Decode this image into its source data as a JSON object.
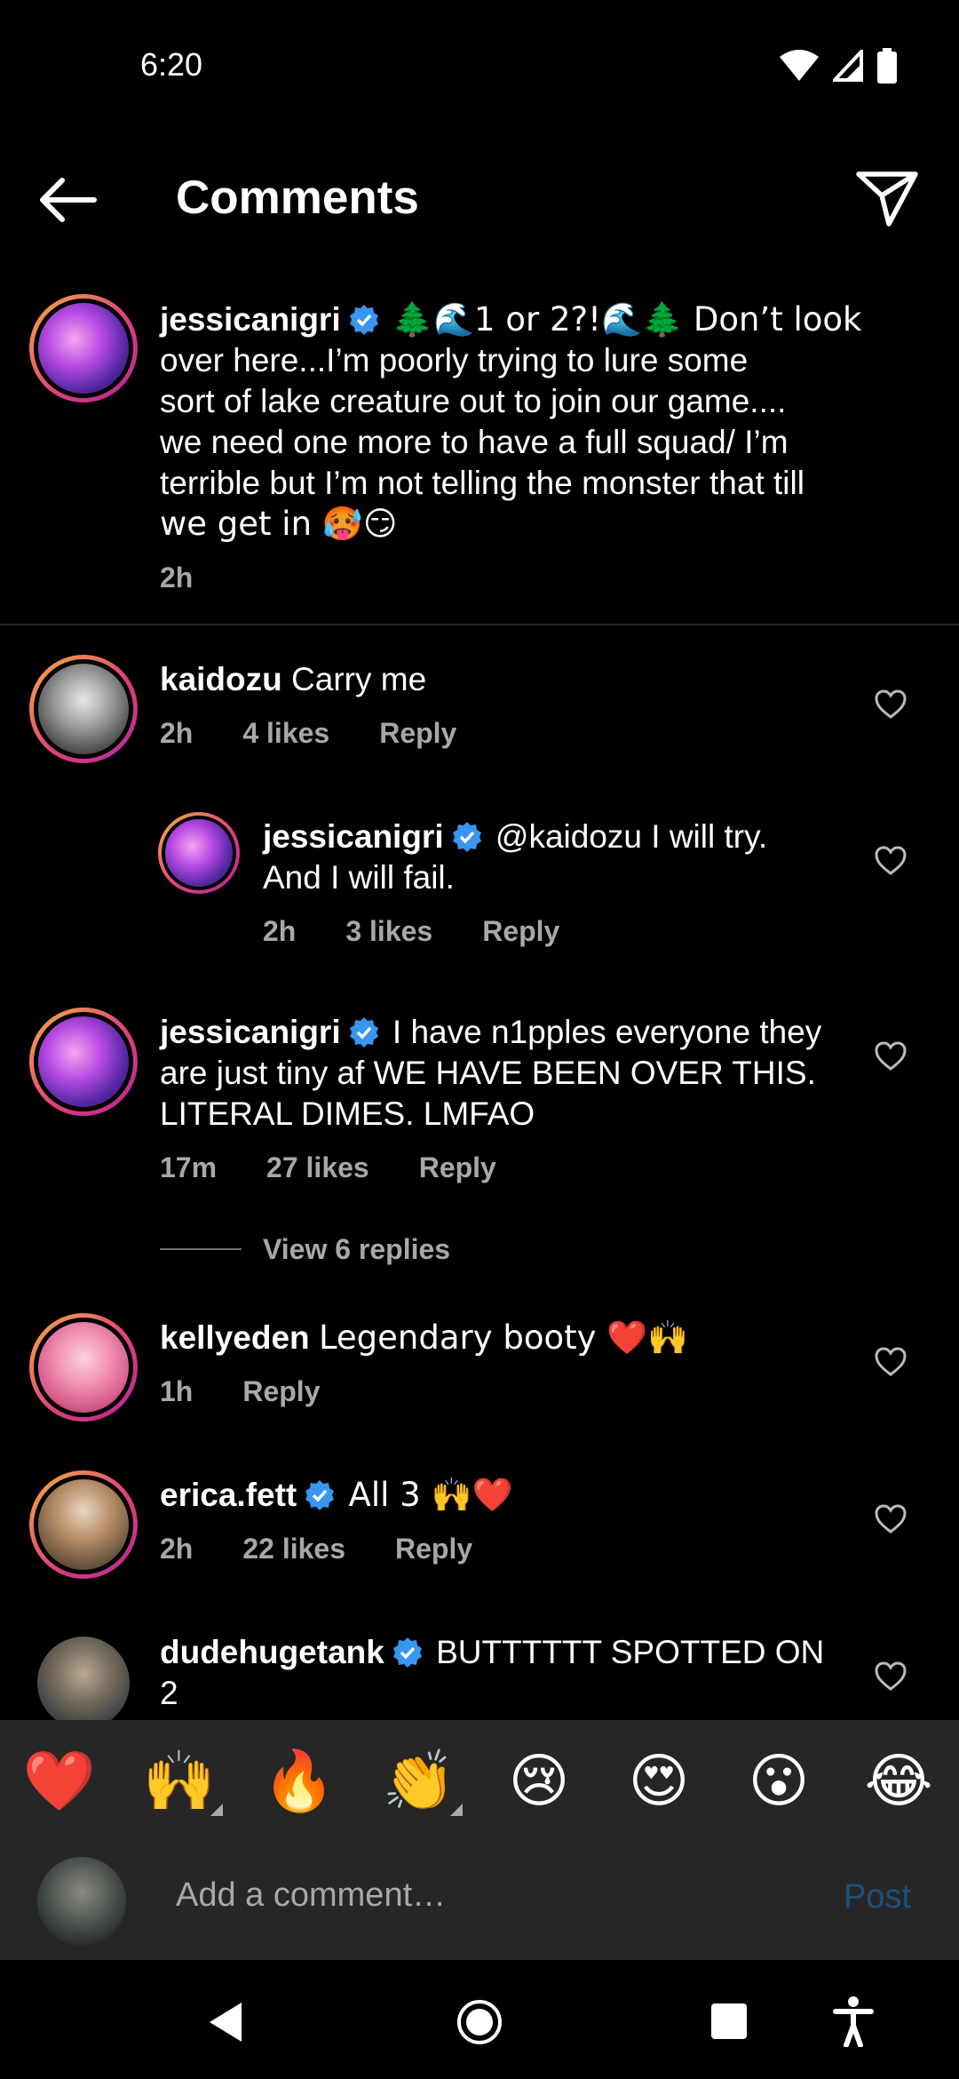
{
  "status_bar": {
    "time": "6:20"
  },
  "header": {
    "title": "Comments"
  },
  "caption": {
    "username": "jessicanigri",
    "text_line1": "🌲🌊1 or 2?!🌊🌲 Don’t look",
    "text_line2": "over here...I’m poorly trying to lure some",
    "text_line3": "sort of lake creature out to join our game....",
    "text_line4": "we need one more to have a full squad/  I’m",
    "text_line5": "terrible but I’m not telling the monster that till",
    "text_line6": "we get in 🥵😏",
    "time": "2h"
  },
  "comments": [
    {
      "username": "kaidozu",
      "text": "Carry me",
      "time": "2h",
      "likes": "4 likes",
      "reply_label": "Reply"
    },
    {
      "username": "jessicanigri",
      "text_line1": "@kaidozu I will try.",
      "text_line2": "And I will fail.",
      "time": "2h",
      "likes": "3 likes",
      "reply_label": "Reply"
    },
    {
      "username": "jessicanigri",
      "text_line1": "I have n1pples everyone they",
      "text_line2": "are just tiny af WE HAVE BEEN OVER THIS.",
      "text_line3": "LITERAL DIMES. LMFAO",
      "time": "17m",
      "likes": "27 likes",
      "reply_label": "Reply",
      "view_replies": "View 6 replies"
    },
    {
      "username": "kellyeden",
      "text": "Legendary booty ❤️🙌",
      "time": "1h",
      "reply_label": "Reply"
    },
    {
      "username": "erica.fett",
      "text": "All 3 🙌❤️",
      "time": "2h",
      "likes": "22 likes",
      "reply_label": "Reply"
    },
    {
      "username": "dudehugetank",
      "text_line1": "BUTTTTTT SPOTTED ON",
      "text_line2": "2"
    }
  ],
  "emoji_bar": [
    "❤️",
    "🙌",
    "🔥",
    "👏",
    "😢",
    "😍",
    "😮",
    "😂"
  ],
  "composer": {
    "placeholder": "Add a comment…",
    "post_label": "Post"
  },
  "colors": {
    "accent_blue": "#3897f0",
    "background": "#000000",
    "panel": "#262626"
  }
}
